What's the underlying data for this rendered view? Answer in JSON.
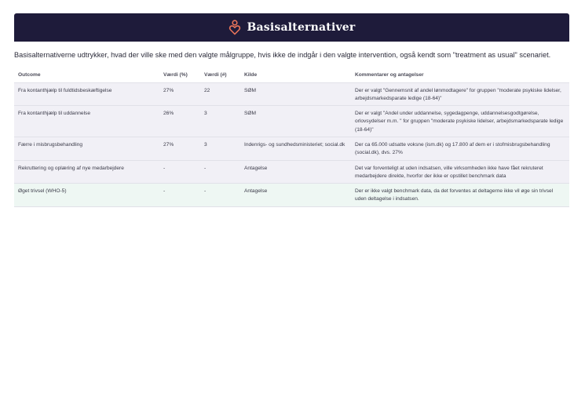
{
  "header": {
    "title": "Basisalternativer",
    "icon": "person-heart-icon",
    "background": "#1e1b3a",
    "icon_color": "#e8745a"
  },
  "intro": "Basisalternativerne udtrykker, hvad der ville ske med den valgte målgruppe, hvis ikke de indgår i den valgte intervention, også kendt som \"treatment as usual\" scenariet.",
  "table": {
    "columns": [
      "Outcome",
      "Værdi (%)",
      "Værdi (#)",
      "Kilde",
      "Kommentarer og antagelser"
    ],
    "rows": [
      {
        "outcome": "Fra kontanthjælp til fuldtidsbeskæftigelse",
        "pct": "27%",
        "num": "22",
        "source": "SØM",
        "comment": "Der er valgt \"Gennemsnit af andel lønmodtagere\" for gruppen \"moderate psykiske lidelser, arbejdsmarkedsparate ledige (18-64)\""
      },
      {
        "outcome": "Fra kontanthjælp til uddannelse",
        "pct": "26%",
        "num": "3",
        "source": "SØM",
        "comment": "Der er valgt \"Andel under uddannelse, sygedagpenge, uddannelsesgodtgørelse, orlovsydelser  m.m. \" for gruppen \"moderate psykiske lidelser, arbejdsmarkedsparate ledige (18-64)\""
      },
      {
        "outcome": "Færre i misbrugsbehandling",
        "pct": "27%",
        "num": "3",
        "source": "Indenrigs- og sundhedsministeriet; social.dk",
        "comment": "Der ca 65.000 udsatte voksne (ism.dk) og 17.800 af dem er i stofmisbrugsbehandling (social.dk), dvs. 27%"
      },
      {
        "outcome": "Rekruttering og oplæring af nye medarbejdere",
        "pct": "-",
        "num": "-",
        "source": "Antagelse",
        "comment": "Det var forventeligt at uden indsatsen, ville virksomheden ikke have fået rekruteret medarbejdere direkte, hvorfor der ikke er opstillet benchmark data"
      },
      {
        "outcome": "Øget trivsel (WHO-5)",
        "pct": "-",
        "num": "-",
        "source": "Antagelse",
        "comment": "Der er ikke valgt benchmark data, da det forventes at deltagerne ikke vil øge sin trivsel uden deltagelse i indsatsen."
      }
    ]
  }
}
